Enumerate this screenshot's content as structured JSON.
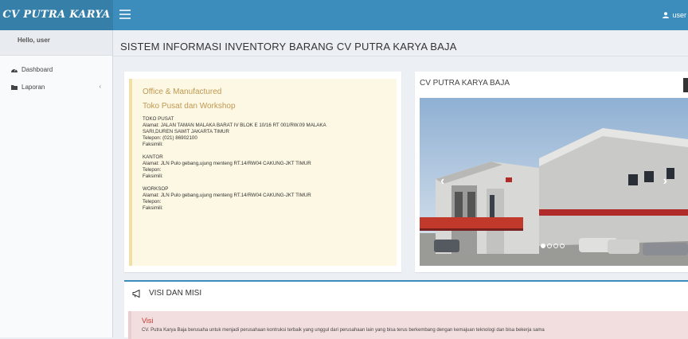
{
  "header": {
    "logo": "CV PUTRA KARYA",
    "user_label": "user"
  },
  "sidebar": {
    "greeting": "Hello, user",
    "items": [
      {
        "label": "Dashboard",
        "icon": "dashboard-icon"
      },
      {
        "label": "Laporan",
        "icon": "folder-icon",
        "expand": "‹"
      }
    ]
  },
  "main": {
    "title": "SISTEM INFORMASI INVENTORY BARANG CV PUTRA KARYA BAJA",
    "info": {
      "heading1": "Office & Manufactured",
      "heading2": "Toko Pusat dan Workshop",
      "toko_title": "TOKO PUSAT",
      "toko_alamat1": "Alamat: JALAN TAMAN MALAKA BARAT IV BLOK E 10/16 RT 001/RW.09 MALAKA",
      "toko_alamat2": "SARI,DUREN SAWIT JAKARTA TIMUR",
      "toko_telepon": "Telepon: (021) 86902100",
      "toko_faks": "Faksimili:",
      "kantor_title": "KANTOR",
      "kantor_alamat": "Alamat: JLN Pulo gebang,ujung menteng RT.14/RW04 CAKUNG-JKT TIMUR",
      "kantor_telepon": "Telepon:",
      "kantor_faks": "Faksimili:",
      "workshop_title": "WORKSOP",
      "workshop_alamat": "Alamat: JLN Pulo gebang,ujung menteng RT.14/RW04 CAKUNG-JKT TIMUR",
      "workshop_telepon": "Telepon:",
      "workshop_faks": "Faksimili:"
    },
    "gallery": {
      "title": "CV PUTRA KARYA BAJA",
      "prev": "‹",
      "next": "›",
      "slides": 4,
      "active_slide": 1
    },
    "visi_misi": {
      "title": "VISI DAN MISI",
      "visi_heading": "Visi",
      "visi_text": "CV. Putra Karya Baja berusaha untuk menjadi perusahaan kontruksi terbaik yang unggul dari perusahaan lain yang bisa terus berkembang dengan kemajuan teknologi dan bisa bekerja sama"
    }
  }
}
